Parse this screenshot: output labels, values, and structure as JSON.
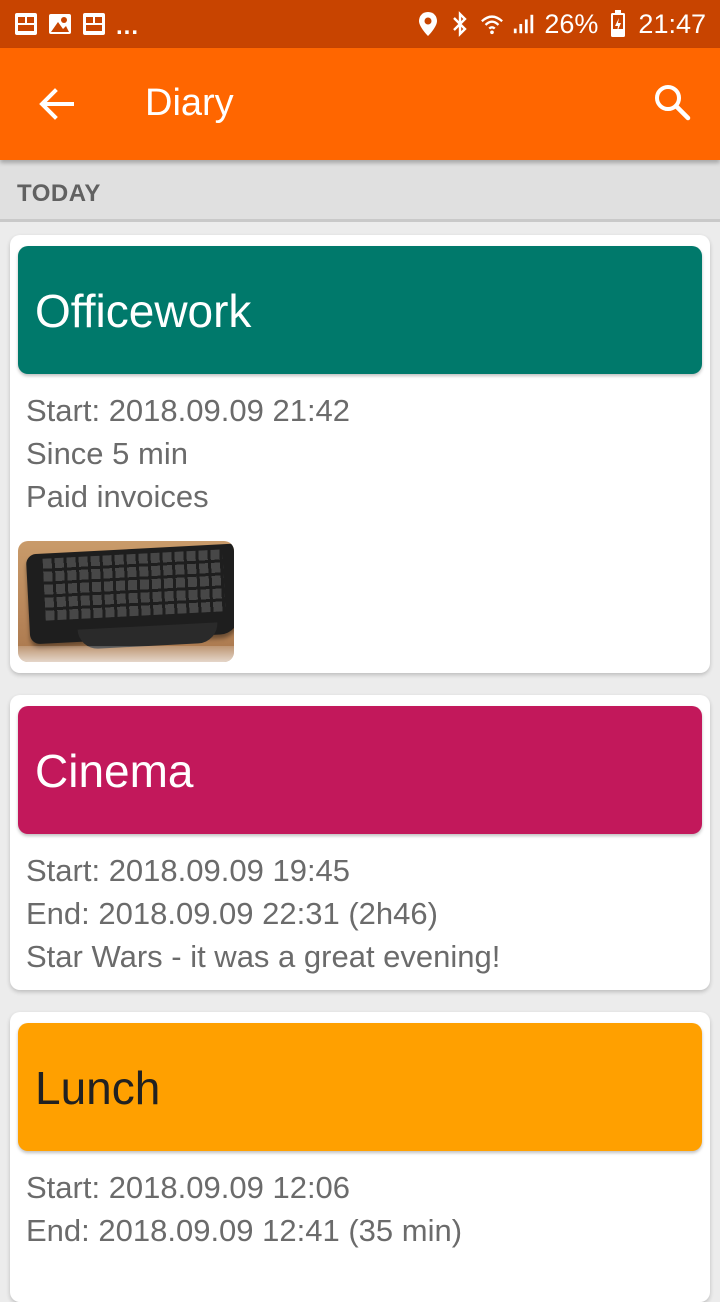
{
  "status_bar": {
    "notification_icons": [
      "app-notification-icon",
      "image-notification-icon",
      "app-notification-icon"
    ],
    "ellipsis": "...",
    "battery_percent": "26%",
    "time": "21:47"
  },
  "app_bar": {
    "title": "Diary",
    "color": "#ff6600"
  },
  "section": {
    "label": "TODAY"
  },
  "entries": [
    {
      "title": "Officework",
      "color": "#00796b",
      "title_color": "#ffffff",
      "lines": [
        "Start: 2018.09.09 21:42",
        "Since 5 min",
        "Paid invoices"
      ],
      "has_photo": true,
      "photo_subject": "keyboard"
    },
    {
      "title": "Cinema",
      "color": "#c2185b",
      "title_color": "#ffffff",
      "lines": [
        "Start: 2018.09.09 19:45",
        "End: 2018.09.09 22:31 (2h46)",
        "Star Wars - it was a great evening!"
      ],
      "has_photo": false
    },
    {
      "title": "Lunch",
      "color": "#ffa000",
      "title_color": "#212121",
      "lines": [
        "Start: 2018.09.09 12:06",
        "End: 2018.09.09 12:41 (35 min)"
      ],
      "has_photo": false
    }
  ]
}
